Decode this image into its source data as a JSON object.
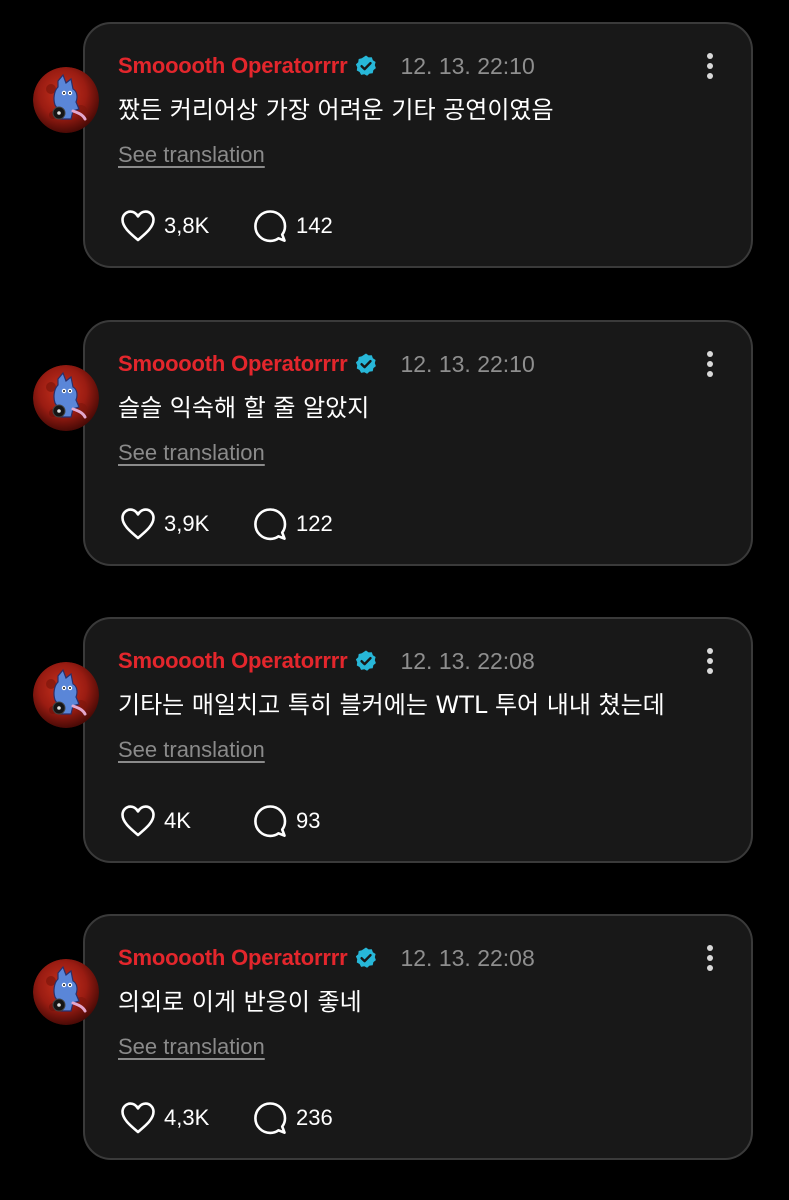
{
  "colors": {
    "background": "#000000",
    "card": "#181818",
    "card_border": "#3a3a3a",
    "author": "#e3262c",
    "verified_badge": "#27b7d8",
    "timestamp": "#8e8e8e",
    "translation_link": "#8a8a8a"
  },
  "icons": {
    "more": "more-vertical-icon",
    "like": "heart-outline-icon",
    "comment": "comment-bubble-icon",
    "verified": "verified-badge-icon"
  },
  "posts": [
    {
      "author": "Smooooth Operatorrrr",
      "timestamp": "12. 13. 22:10",
      "text": "짰든 커리어상 가장 어려운 기타 공연이였음",
      "translate_label": "See translation",
      "likes": "3,8K",
      "comments": "142"
    },
    {
      "author": "Smooooth Operatorrrr",
      "timestamp": "12. 13. 22:10",
      "text": "슬슬 익숙해 할 줄 알았지",
      "translate_label": "See translation",
      "likes": "3,9K",
      "comments": "122"
    },
    {
      "author": "Smooooth Operatorrrr",
      "timestamp": "12. 13. 22:08",
      "text": "기타는 매일치고 특히 블커에는 WTL 투어 내내 쳤는데",
      "translate_label": "See translation",
      "likes": "4K",
      "comments": "93"
    },
    {
      "author": "Smooooth Operatorrrr",
      "timestamp": "12. 13. 22:08",
      "text": "의외로 이게 반응이 좋네",
      "translate_label": "See translation",
      "likes": "4,3K",
      "comments": "236"
    }
  ]
}
